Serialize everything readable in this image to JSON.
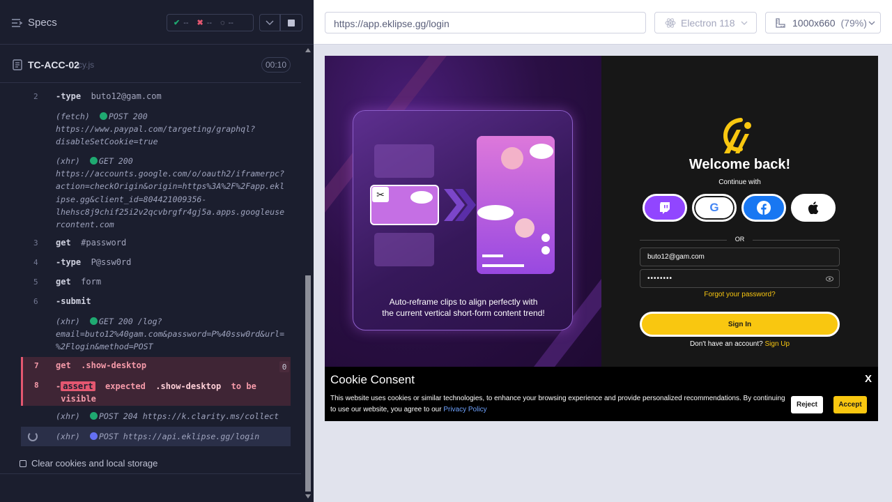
{
  "reporter": {
    "specs_label": "Specs",
    "stats": {
      "passed": "--",
      "failed": "--",
      "pending": "--"
    },
    "test_title": "TC-ACC-02",
    "test_file": "cy.js",
    "duration": "00:10",
    "commands": {
      "c2": {
        "num": "2",
        "name": "-type",
        "value": "buto12@gam.com"
      },
      "x1": {
        "kind": "(fetch)",
        "method": "POST 200",
        "url_lines": [
          "https://www.paypal.com/targeting/graphql?",
          "disableSetCookie=true"
        ]
      },
      "x2": {
        "kind": "(xhr)",
        "method": "GET 200",
        "url_lines": [
          "https://accounts.google.com/o/oauth2/iframerpc?",
          "action=checkOrigin&origin=https%3A%2F%2Fapp.ekl",
          "ipse.gg&client_id=804421009356-",
          "lhehsc8j9chif25i2v2qcvbrgfr4gj5a.apps.googleuse",
          "rcontent.com"
        ]
      },
      "c3": {
        "num": "3",
        "name": "get",
        "value": "#password"
      },
      "c4": {
        "num": "4",
        "name": "-type",
        "value": "P@ssw0rd"
      },
      "c5": {
        "num": "5",
        "name": "get",
        "value": "form"
      },
      "c6": {
        "num": "6",
        "name": "-submit",
        "value": ""
      },
      "x3": {
        "kind": "(xhr)",
        "method": "GET 200 /log?",
        "url_lines": [
          "email=buto12%40gam.com&password=P%40ssw0rd&url=",
          "%2Flogin&method=POST"
        ]
      },
      "c7": {
        "num": "7",
        "name": "get",
        "value": ".show-desktop",
        "count": "0"
      },
      "c8": {
        "num": "8",
        "dash": "-",
        "badge": "assert",
        "text1": "expected",
        "target": ".show-desktop",
        "text2": "to be",
        "text3": "visible"
      },
      "x4": {
        "kind": "(xhr)",
        "method": "POST 204",
        "url": "https://k.clarity.ms/collect"
      },
      "x5": {
        "kind": "(xhr)",
        "method": "POST",
        "url": "https://api.eklipse.gg/login"
      }
    },
    "clear_label": "Clear cookies and local storage"
  },
  "aut": {
    "url": "https://app.eklipse.gg/login",
    "browser": "Electron 118",
    "viewport": "1000x660",
    "zoom": "(79%)"
  },
  "app": {
    "promo_text_lines": [
      "Auto-reframe clips to align perfectly with",
      "the current vertical short-form content trend!"
    ],
    "welcome": "Welcome back!",
    "continue_with": "Continue with",
    "or": "OR",
    "email_value": "buto12@gam.com",
    "password_value": "••••••••",
    "forgot": "Forgot your password?",
    "signin": "Sign In",
    "no_account": "Don't have an account?",
    "signup": "Sign Up",
    "colors": {
      "accent": "#f9c710",
      "twitch": "#9146ff",
      "facebook": "#1877f2"
    }
  },
  "cookie": {
    "title": "Cookie Consent",
    "close": "X",
    "text": "This website uses cookies or similar technologies, to enhance your browsing experience and provide personalized recommendations. By continuing to use our website, you agree to our",
    "policy_link": "Privacy Policy",
    "reject": "Reject",
    "accept": "Accept"
  }
}
